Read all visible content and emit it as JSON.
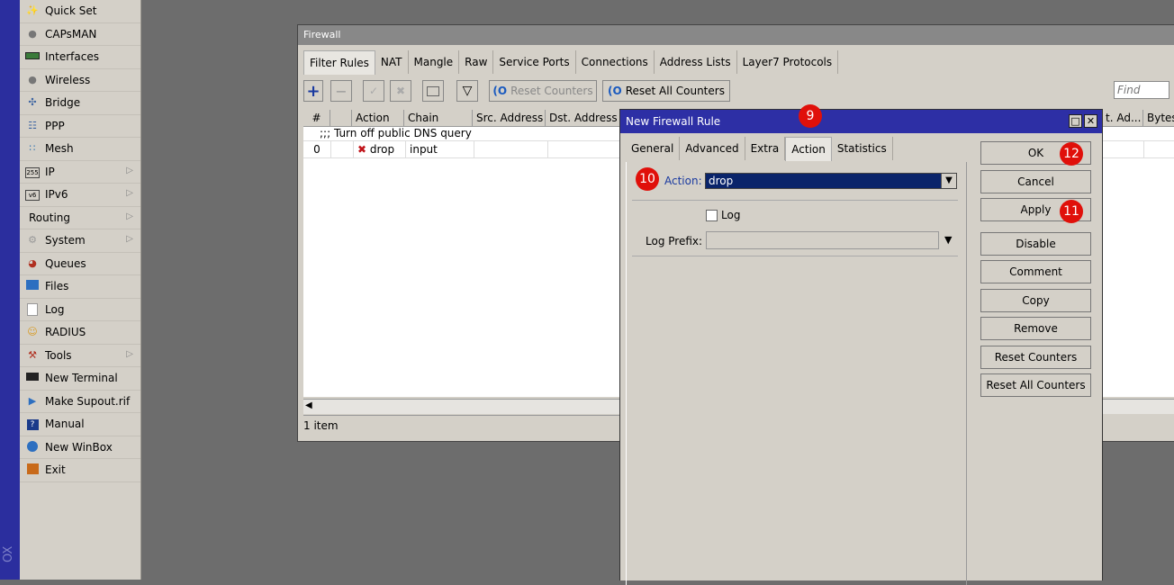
{
  "vertical_text": "OX",
  "sidebar": {
    "items": [
      {
        "label": "Quick Set",
        "icon": "wand-icon",
        "arrow": false
      },
      {
        "label": "CAPsMAN",
        "icon": "capsman-icon",
        "arrow": false
      },
      {
        "label": "Interfaces",
        "icon": "interfaces-icon",
        "arrow": false
      },
      {
        "label": "Wireless",
        "icon": "wireless-icon",
        "arrow": false
      },
      {
        "label": "Bridge",
        "icon": "bridge-icon",
        "arrow": false
      },
      {
        "label": "PPP",
        "icon": "ppp-icon",
        "arrow": false
      },
      {
        "label": "Mesh",
        "icon": "mesh-icon",
        "arrow": false
      },
      {
        "label": "IP",
        "icon": "ip-icon",
        "arrow": true
      },
      {
        "label": "IPv6",
        "icon": "ipv6-icon",
        "arrow": true
      },
      {
        "label": "Routing",
        "icon": "",
        "arrow": true
      },
      {
        "label": "System",
        "icon": "system-icon",
        "arrow": true
      },
      {
        "label": "Queues",
        "icon": "queues-icon",
        "arrow": false
      },
      {
        "label": "Files",
        "icon": "files-icon",
        "arrow": false
      },
      {
        "label": "Log",
        "icon": "log-icon",
        "arrow": false
      },
      {
        "label": "RADIUS",
        "icon": "radius-icon",
        "arrow": false
      },
      {
        "label": "Tools",
        "icon": "tools-icon",
        "arrow": true
      },
      {
        "label": "New Terminal",
        "icon": "terminal-icon",
        "arrow": false
      },
      {
        "label": "Make Supout.rif",
        "icon": "supout-icon",
        "arrow": false
      },
      {
        "label": "Manual",
        "icon": "manual-icon",
        "arrow": false
      },
      {
        "label": "New WinBox",
        "icon": "winbox-icon",
        "arrow": false
      },
      {
        "label": "Exit",
        "icon": "exit-icon",
        "arrow": false
      }
    ]
  },
  "firewall": {
    "title": "Firewall",
    "tabs": [
      "Filter Rules",
      "NAT",
      "Mangle",
      "Raw",
      "Service Ports",
      "Connections",
      "Address Lists",
      "Layer7 Protocols"
    ],
    "toolbar": {
      "reset_counters": "Reset Counters",
      "reset_all_counters": "Reset All Counters",
      "find_placeholder": "Find"
    },
    "columns": [
      "#",
      "",
      "Action",
      "Chain",
      "Src. Address",
      "Dst. Address"
    ],
    "columns_right": [
      "t. Ad...",
      "Bytes"
    ],
    "comment_row": ";;; Turn off public DNS query",
    "rows": [
      {
        "num": "0",
        "action": "drop",
        "chain": "input"
      }
    ],
    "status": "1 item"
  },
  "dialog": {
    "title": "New Firewall Rule",
    "tabs": [
      "General",
      "Advanced",
      "Extra",
      "Action",
      "Statistics"
    ],
    "action_label": "Action:",
    "action_value": "drop",
    "log_label": "Log",
    "log_prefix_label": "Log Prefix:",
    "buttons": [
      "OK",
      "Cancel",
      "Apply",
      "Disable",
      "Comment",
      "Copy",
      "Remove",
      "Reset Counters",
      "Reset All Counters"
    ]
  },
  "badges": {
    "b9": "9",
    "b10": "10",
    "b11": "11",
    "b12": "12"
  },
  "colors": {
    "accent": "#2d2fa5",
    "badge": "#e0100a",
    "drop_icon": "#c0141a"
  }
}
